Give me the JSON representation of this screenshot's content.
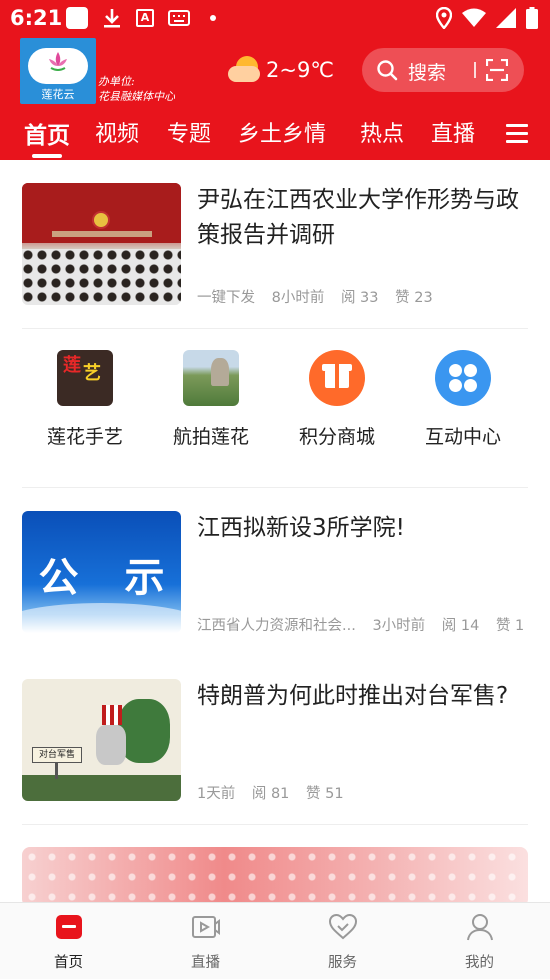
{
  "status_bar": {
    "time": "6:21",
    "left_icons": [
      "square-app-icon",
      "download-icon",
      "text-icon",
      "keyboard-icon",
      "dot-icon"
    ],
    "right_icons": [
      "location-icon",
      "wifi-icon",
      "signal-icon",
      "battery-icon"
    ]
  },
  "header": {
    "logo_text": "莲花云",
    "org_line1": "办单位:",
    "org_line2": "花县融媒体中心",
    "weather_temp": "2~9℃",
    "search_label": "搜索",
    "accent_color": "#e8141c"
  },
  "nav_tabs": [
    {
      "label": "首页",
      "active": true
    },
    {
      "label": "视频",
      "active": false
    },
    {
      "label": "专题",
      "active": false
    },
    {
      "label": "乡土乡情",
      "active": false
    },
    {
      "label": "热点",
      "active": false
    },
    {
      "label": "直播",
      "active": false
    }
  ],
  "news": [
    {
      "title": "尹弘在江西农业大学作形势与政策报告并调研",
      "source": "一键下发",
      "time": "8小时前",
      "reads": "阅 33",
      "likes": "赞 23"
    },
    {
      "title": "江西拟新设3所学院!",
      "thumb_text": "公 示",
      "source": "江西省人力资源和社会...",
      "time": "3小时前",
      "reads": "阅 14",
      "likes": "赞 1"
    },
    {
      "title": "特朗普为何此时推出对台军售?",
      "thumb_sign": "对台军售",
      "time": "1天前",
      "reads": "阅 81",
      "likes": "赞 51"
    }
  ],
  "quick_links": [
    {
      "label": "莲花手艺",
      "icon": "craft-thumbnail"
    },
    {
      "label": "航拍莲花",
      "icon": "aerial-thumbnail"
    },
    {
      "label": "积分商城",
      "icon": "gift-icon"
    },
    {
      "label": "互动中心",
      "icon": "clover-icon"
    }
  ],
  "bottom_nav": [
    {
      "label": "首页",
      "icon": "home-icon",
      "active": true
    },
    {
      "label": "直播",
      "icon": "live-video-icon",
      "active": false
    },
    {
      "label": "服务",
      "icon": "heart-icon",
      "active": false
    },
    {
      "label": "我的",
      "icon": "profile-icon",
      "active": false
    }
  ]
}
